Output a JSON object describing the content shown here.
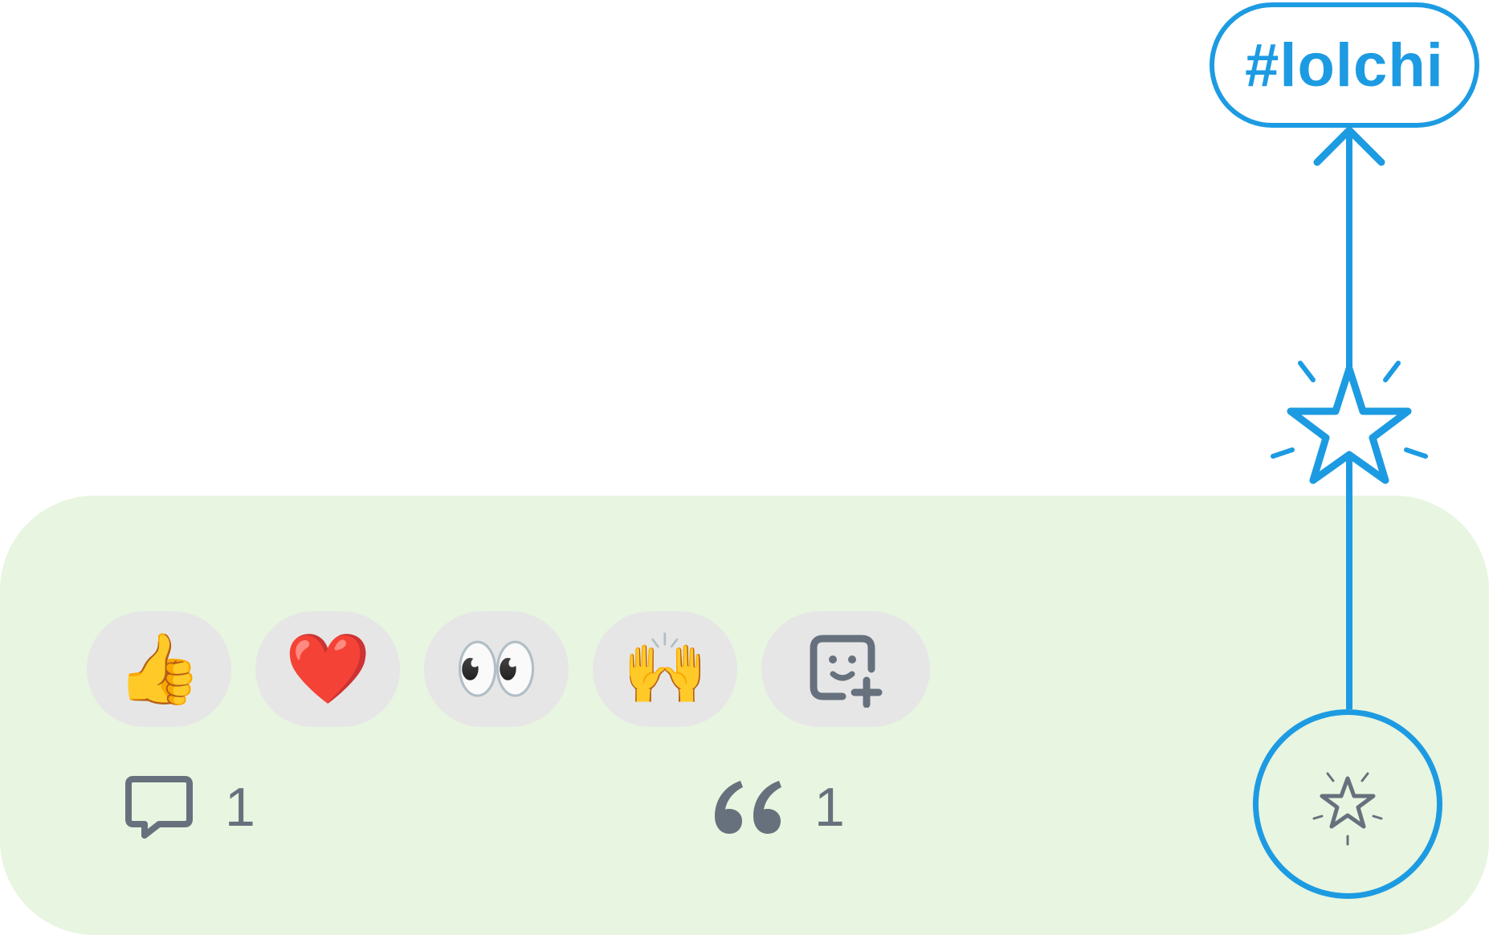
{
  "post": {
    "reactions": [
      {
        "emoji": "👍",
        "name": "thumbs-up"
      },
      {
        "emoji": "❤️",
        "name": "heart"
      },
      {
        "emoji": "👀",
        "name": "eyes"
      },
      {
        "emoji": "🙌",
        "name": "raising-hands"
      }
    ],
    "add_reaction_icon": "add-reaction-icon",
    "comments": {
      "count": "1",
      "icon": "comment-icon"
    },
    "quotes": {
      "count": "1",
      "icon": "quote-icon"
    },
    "boost_icon": "sparkle-star-icon"
  },
  "annotation": {
    "hashtag": "#lolchi",
    "accent_color": "#1d9be2"
  },
  "colors": {
    "panel_background": "#e8f5e0",
    "reaction_background": "#e6e6e6",
    "icon_gray": "#66717d"
  }
}
